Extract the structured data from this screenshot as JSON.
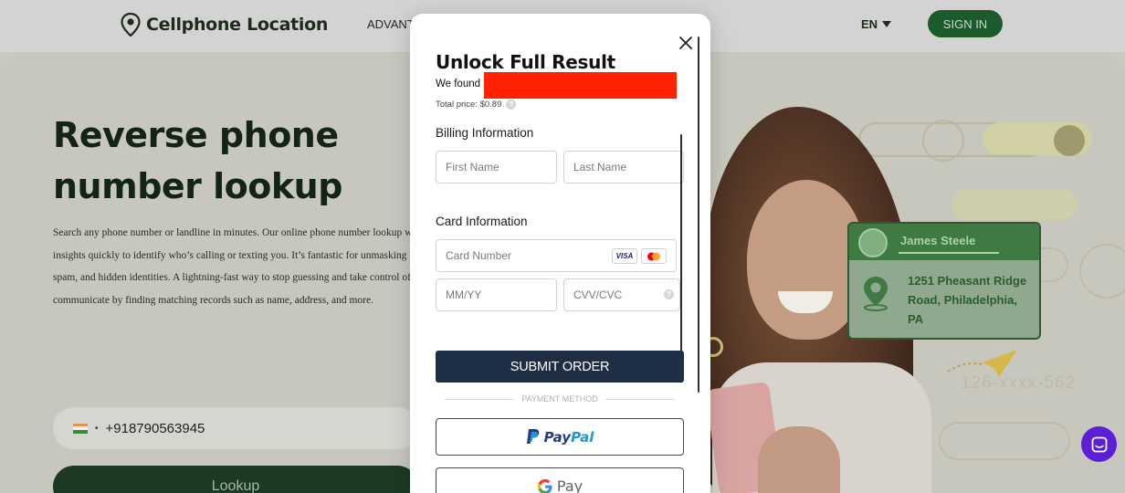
{
  "header": {
    "logo_text": "Cellphone Location",
    "nav_item": "ADVANT",
    "language": "EN",
    "signin_label": "SIGN IN"
  },
  "hero": {
    "title": "Reverse phone number lookup",
    "description_lines": [
      "Search any phone number or landline in minutes. Our online phone number lookup will r",
      "insights quickly to identify who’s calling or texting you. It’s fantastic for unmasking myst",
      "spam, and hidden identities. A lightning-fast way to stop guessing and take control of hov",
      "communicate by finding matching records such as name, address, and more."
    ],
    "phone_value": "+918790563945",
    "lookup_label": "Lookup"
  },
  "illustration": {
    "card_name": "James Steele",
    "card_address": "1251 Pheasant Ridge Road, Philadelphia, PA",
    "ghost_number": "126-xxxx-562"
  },
  "modal": {
    "title": "Unlock Full Result",
    "found_label": "We found",
    "total_price": "Total price: $0.89",
    "billing_label": "Billing Information",
    "first_name_placeholder": "First Name",
    "last_name_placeholder": "Last Name",
    "card_label": "Card Information",
    "card_number_placeholder": "Card Number",
    "card_badges": [
      "VISA",
      "mastercard"
    ],
    "expiry_placeholder": "MM/YY",
    "cvv_placeholder": "CVV/CVC",
    "submit_label": "SUBMIT ORDER",
    "payment_method_label": "PAYMENT METHOD",
    "paypal": {
      "pay": "Pay",
      "pal": "Pal"
    },
    "gpay_label": "Pay"
  },
  "colors": {
    "brand_green": "#1e5b2c",
    "submit_navy": "#1e2e44",
    "redaction_red": "#ff2200",
    "chat_purple": "#5b1fd6"
  }
}
